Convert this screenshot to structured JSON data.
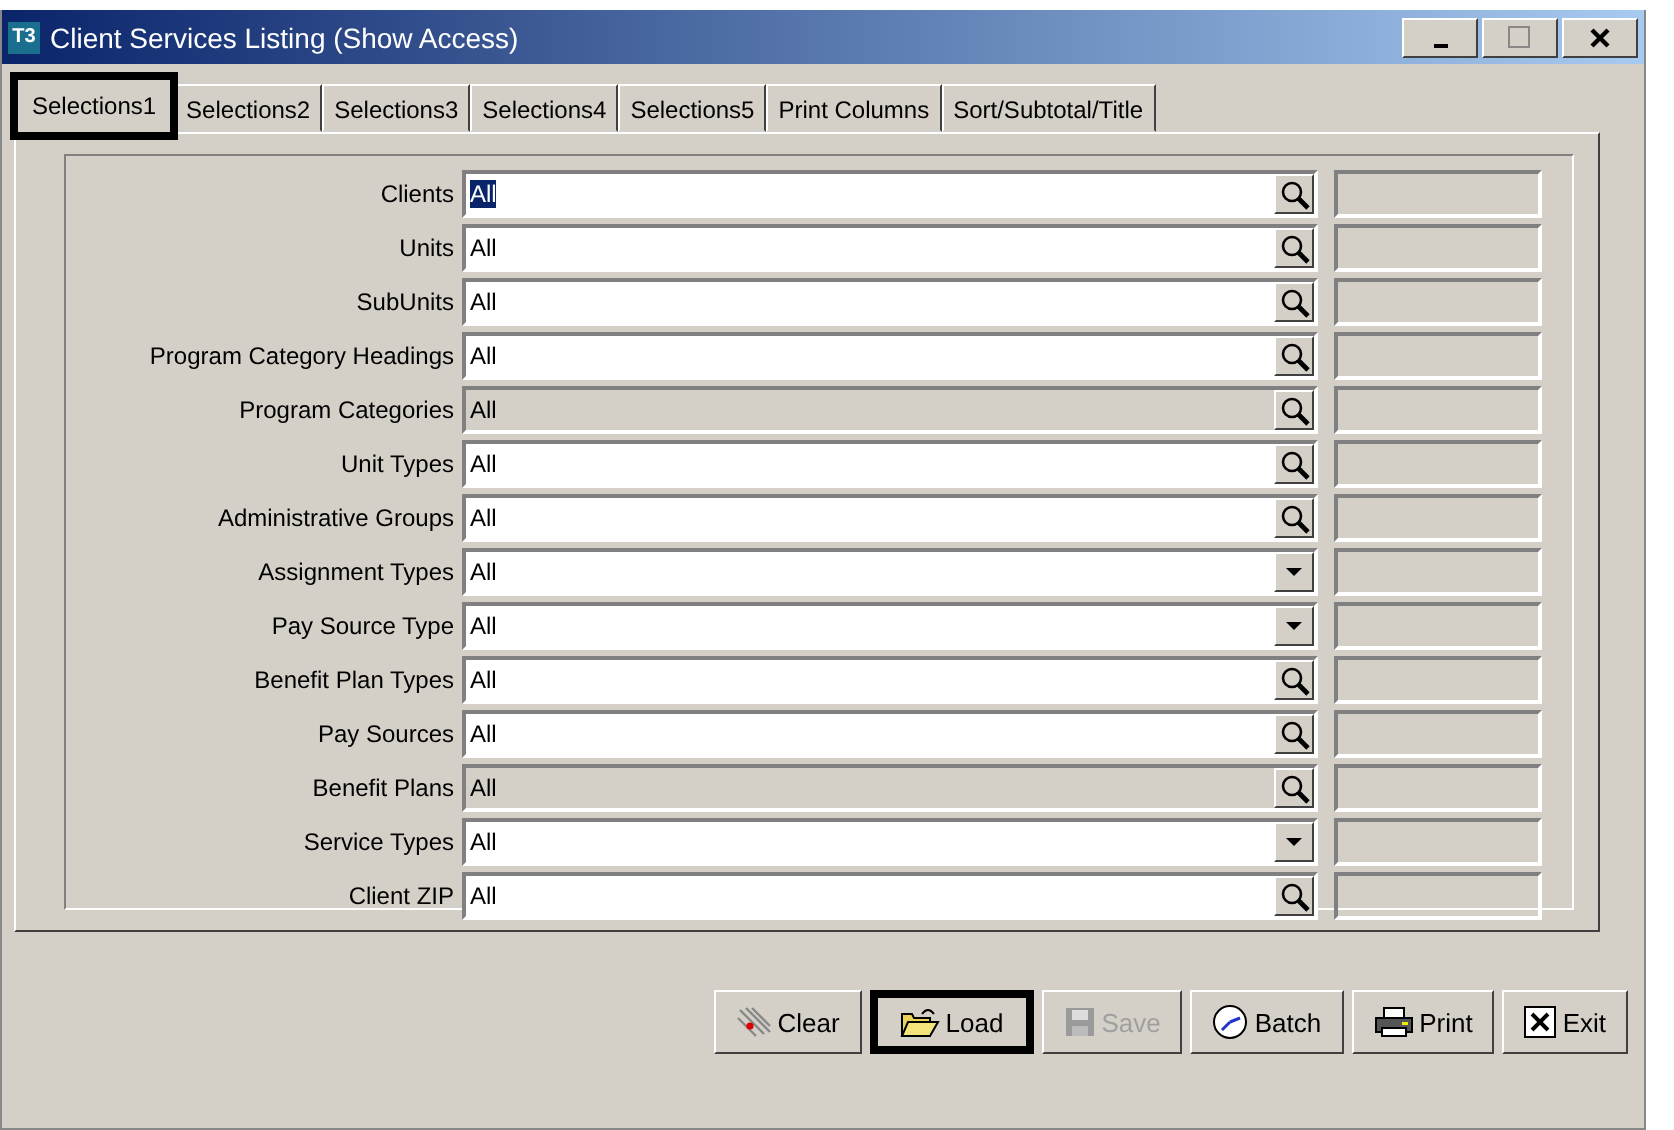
{
  "window": {
    "title": "Client Services Listing (Show Access)",
    "app_icon": "T3"
  },
  "tabs": [
    {
      "label": "Selections1",
      "selected": true,
      "highlighted": true
    },
    {
      "label": "Selections2",
      "selected": false,
      "highlighted": false
    },
    {
      "label": "Selections3",
      "selected": false,
      "highlighted": false
    },
    {
      "label": "Selections4",
      "selected": false,
      "highlighted": false
    },
    {
      "label": "Selections5",
      "selected": false,
      "highlighted": false
    },
    {
      "label": "Print Columns",
      "selected": false,
      "highlighted": false
    },
    {
      "label": "Sort/Subtotal/Title",
      "selected": false,
      "highlighted": false
    }
  ],
  "fields": [
    {
      "label": "Clients",
      "value": "All",
      "kind": "lookup",
      "disabled": false,
      "text_selected": true
    },
    {
      "label": "Units",
      "value": "All",
      "kind": "lookup",
      "disabled": false,
      "text_selected": false
    },
    {
      "label": "SubUnits",
      "value": "All",
      "kind": "lookup",
      "disabled": false,
      "text_selected": false
    },
    {
      "label": "Program Category Headings",
      "value": "All",
      "kind": "lookup",
      "disabled": false,
      "text_selected": false
    },
    {
      "label": "Program Categories",
      "value": "All",
      "kind": "lookup",
      "disabled": true,
      "text_selected": false
    },
    {
      "label": "Unit Types",
      "value": "All",
      "kind": "lookup",
      "disabled": false,
      "text_selected": false
    },
    {
      "label": "Administrative Groups",
      "value": "All",
      "kind": "lookup",
      "disabled": false,
      "text_selected": false
    },
    {
      "label": "Assignment Types",
      "value": "All",
      "kind": "dropdown",
      "disabled": false,
      "text_selected": false
    },
    {
      "label": "Pay Source Type",
      "value": "All",
      "kind": "dropdown",
      "disabled": false,
      "text_selected": false
    },
    {
      "label": "Benefit Plan Types",
      "value": "All",
      "kind": "lookup",
      "disabled": false,
      "text_selected": false
    },
    {
      "label": "Pay Sources",
      "value": "All",
      "kind": "lookup",
      "disabled": false,
      "text_selected": false
    },
    {
      "label": "Benefit Plans",
      "value": "All",
      "kind": "lookup",
      "disabled": true,
      "text_selected": false
    },
    {
      "label": "Service Types",
      "value": "All",
      "kind": "dropdown",
      "disabled": false,
      "text_selected": false
    },
    {
      "label": "Client ZIP",
      "value": "All",
      "kind": "lookup",
      "disabled": false,
      "text_selected": false
    }
  ],
  "buttons": [
    {
      "label": "Clear",
      "kind": "clear",
      "disabled": false,
      "highlighted": false
    },
    {
      "label": "Load",
      "kind": "load",
      "disabled": false,
      "highlighted": true
    },
    {
      "label": "Save",
      "kind": "save",
      "disabled": true,
      "highlighted": false
    },
    {
      "label": "Batch",
      "kind": "batch",
      "disabled": false,
      "highlighted": false
    },
    {
      "label": "Print",
      "kind": "print",
      "disabled": false,
      "highlighted": false
    },
    {
      "label": "Exit",
      "kind": "exit",
      "disabled": false,
      "highlighted": false
    }
  ]
}
